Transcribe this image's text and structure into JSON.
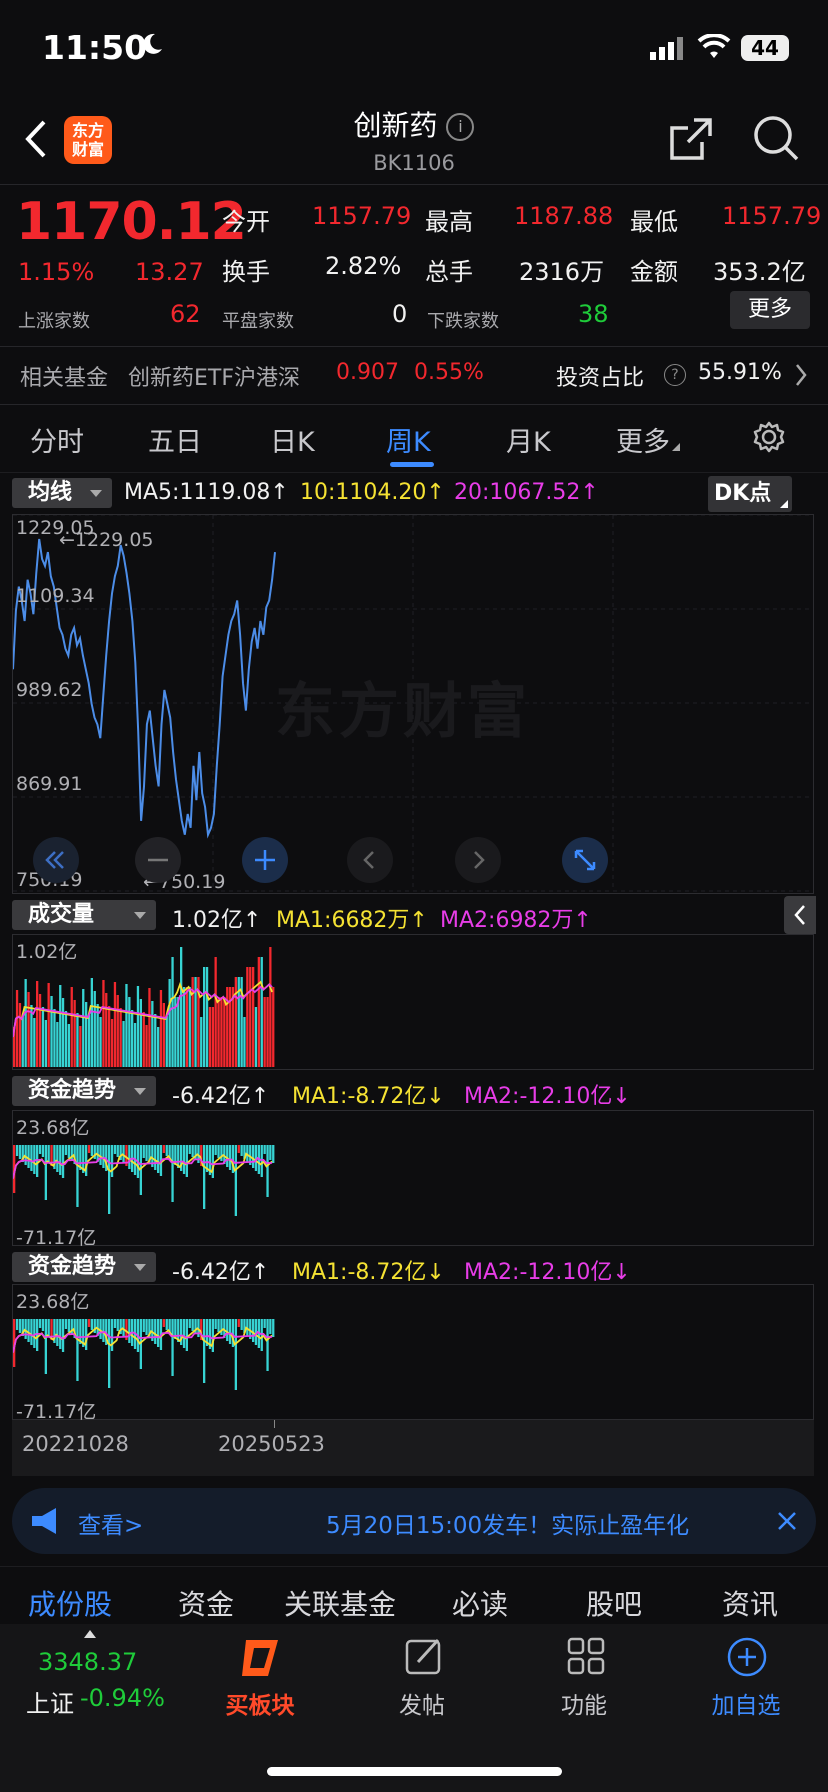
{
  "status_bar": {
    "time": "11:50",
    "battery": "44"
  },
  "header": {
    "logo_line1": "东方",
    "logo_line2": "财富",
    "title": "创新药",
    "code": "BK1106"
  },
  "quote": {
    "price": "1170.12",
    "change_pct": "1.15%",
    "change": "13.27",
    "open_label": "今开",
    "open": "1157.79",
    "high_label": "最高",
    "high": "1187.88",
    "low_label": "最低",
    "low": "1157.79",
    "turnover_label": "换手",
    "turnover": "2.82%",
    "volume_label": "总手",
    "volume": "2316万",
    "amount_label": "金额",
    "amount": "353.2亿",
    "up_label": "上涨家数",
    "up": "62",
    "flat_label": "平盘家数",
    "flat": "0",
    "down_label": "下跌家数",
    "down": "38",
    "more": "更多"
  },
  "fund": {
    "label": "相关基金",
    "name": "创新药ETF沪港深",
    "price": "0.907",
    "pct": "0.55%",
    "ratio_label": "投资占比",
    "ratio": "55.91%"
  },
  "tabs": [
    "分时",
    "五日",
    "日K",
    "周K",
    "月K",
    "更多"
  ],
  "main_chart": {
    "indicator": "均线",
    "ma5": "MA5:1119.08↑",
    "ma10": "10:1104.20↑",
    "ma20": "20:1067.52↑",
    "dk": "DK点",
    "y_ticks": [
      "1229.05",
      "1109.34",
      "989.62",
      "869.91",
      "750.19"
    ],
    "max_label": "←1229.05",
    "min_label": "←750.19",
    "watermark": "东方财富"
  },
  "volume_panel": {
    "indicator": "成交量",
    "value": "1.02亿↑",
    "ma1": "MA1:6682万↑",
    "ma2": "MA2:6982万↑",
    "top": "1.02亿"
  },
  "flow_panel_1": {
    "indicator": "资金趋势",
    "value": "-6.42亿↑",
    "ma1": "MA1:-8.72亿↓",
    "ma2": "MA2:-12.10亿↓",
    "top": "23.68亿",
    "bottom": "-71.17亿"
  },
  "flow_panel_2": {
    "indicator": "资金趋势",
    "value": "-6.42亿↑",
    "ma1": "MA1:-8.72亿↓",
    "ma2": "MA2:-12.10亿↓",
    "top": "23.68亿",
    "bottom": "-71.17亿"
  },
  "x_axis": {
    "start": "20221028",
    "end": "20250523"
  },
  "banner": {
    "view": "查看>",
    "text": "5月20日15:00发车！实际止盈年化"
  },
  "bottom_tabs": [
    "成份股",
    "资金",
    "关联基金",
    "必读",
    "股吧",
    "资讯"
  ],
  "index_ticker": {
    "value": "3348.37",
    "name": "上证",
    "pct": "-0.94%"
  },
  "nav": [
    "买板块",
    "发帖",
    "功能",
    "加自选"
  ],
  "colors": {
    "up": "#f2282e",
    "down": "#1fcc3a",
    "accent": "#3d8bff",
    "ma_yellow": "#f5e233",
    "ma_magenta": "#e83de8",
    "bar_cyan": "#37d4d4"
  },
  "chart_data": {
    "type": "line",
    "title": "",
    "ylim": [
      750.19,
      1229.05
    ],
    "x_range": [
      "20221028",
      "20250523"
    ],
    "series": [
      {
        "values": [
          1040,
          1125,
          1160,
          1140,
          1110,
          1170,
          1150,
          1120,
          1180,
          1229,
          1200,
          1190,
          1210,
          1175,
          1160,
          1130,
          1100,
          1090,
          1070,
          1060,
          1090,
          1100,
          1075,
          1085,
          1060,
          1040,
          1020,
          990,
          970,
          960,
          940,
          1000,
          1060,
          1110,
          1150,
          1175,
          1190,
          1220,
          1205,
          1180,
          1150,
          1110,
          1050,
          950,
          820,
          870,
          960,
          980,
          940,
          900,
          870,
          960,
          1010,
          990,
          970,
          920,
          880,
          850,
          820,
          800,
          830,
          810,
          900,
          850,
          920,
          860,
          840,
          800,
          810,
          830,
          900,
          960,
          1030,
          1060,
          1090,
          1110,
          1120,
          1140,
          1090,
          1020,
          980,
          1040,
          1080,
          1100,
          1070,
          1110,
          1090,
          1130,
          1140,
          1170,
          1210
        ]
      }
    ]
  }
}
